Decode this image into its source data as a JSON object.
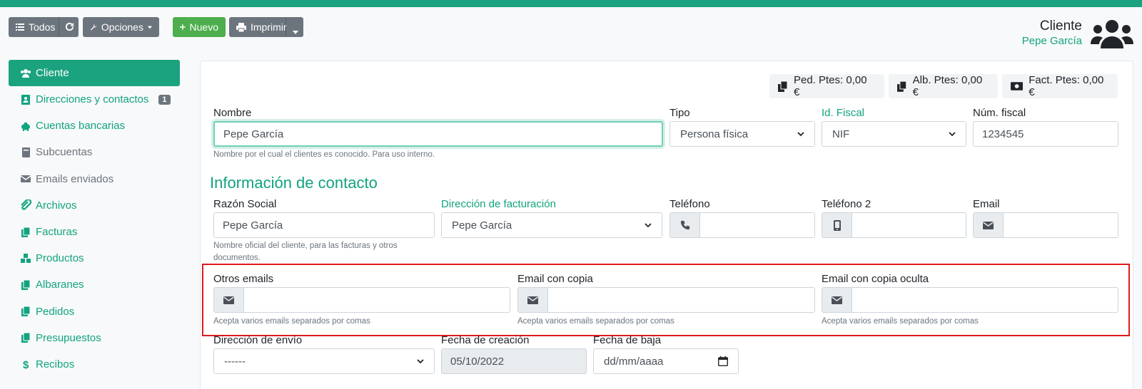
{
  "toolbar": {
    "all_label": "Todos",
    "options_label": "Opciones",
    "new_label": "Nuevo",
    "print_label": "Imprimir"
  },
  "header": {
    "title": "Cliente",
    "client_name": "Pepe García"
  },
  "sidebar": {
    "items": [
      {
        "label": "Cliente",
        "icon": "users-icon"
      },
      {
        "label": "Direcciones y contactos",
        "icon": "address-book-icon",
        "badge": "1"
      },
      {
        "label": "Cuentas bancarias",
        "icon": "piggy-bank-icon"
      },
      {
        "label": "Subcuentas",
        "icon": "book-icon"
      },
      {
        "label": "Emails enviados",
        "icon": "envelope-icon"
      },
      {
        "label": "Archivos",
        "icon": "paperclip-icon"
      },
      {
        "label": "Facturas",
        "icon": "copy-icon"
      },
      {
        "label": "Productos",
        "icon": "cubes-icon"
      },
      {
        "label": "Albaranes",
        "icon": "copy-icon"
      },
      {
        "label": "Pedidos",
        "icon": "copy-icon"
      },
      {
        "label": "Presupuestos",
        "icon": "copy-icon"
      },
      {
        "label": "Recibos",
        "icon": "dollar-icon"
      }
    ]
  },
  "pending": {
    "orders": "Ped. Ptes: 0,00 €",
    "delivery_notes": "Alb. Ptes: 0,00 €",
    "invoices": "Fact. Ptes: 0,00 €"
  },
  "form": {
    "nombre_label": "Nombre",
    "nombre_value": "Pepe García",
    "nombre_help": "Nombre por el cual el clientes es conocido. Para uso interno.",
    "tipo_label": "Tipo",
    "tipo_value": "Persona física",
    "idfiscal_label": "Id. Fiscal",
    "idfiscal_value": "NIF",
    "numfiscal_label": "Núm. fiscal",
    "numfiscal_value": "1234545",
    "contact_section": "Información de contacto",
    "razon_label": "Razón Social",
    "razon_value": "Pepe García",
    "razon_help": "Nombre oficial del cliente, para las facturas y otros documentos.",
    "facturacion_label": "Dirección de facturación",
    "facturacion_value": "Pepe García",
    "telefono_label": "Teléfono",
    "telefono2_label": "Teléfono 2",
    "email_label": "Email",
    "otros_label": "Otros emails",
    "cc_label": "Email con copia",
    "bcc_label": "Email con copia oculta",
    "multi_help": "Acepta varios emails separados por comas",
    "envio_label": "Dirección de envío",
    "envio_value": "------",
    "creacion_label": "Fecha de creación",
    "creacion_value": "05/10/2022",
    "baja_label": "Fecha de baja",
    "baja_placeholder": "dd/mm/aaaa"
  },
  "colors": {
    "accent": "#1aa37e",
    "highlight": "#e01b1b"
  }
}
